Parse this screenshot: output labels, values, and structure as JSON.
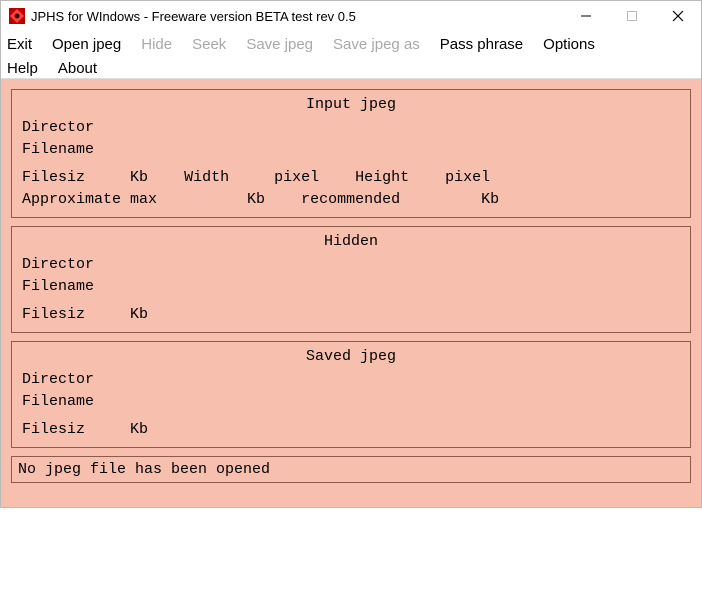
{
  "titlebar": {
    "title": "JPHS for WIndows - Freeware version BETA test rev 0.5"
  },
  "menu": {
    "row1": {
      "exit": "Exit",
      "open_jpeg": "Open jpeg",
      "hide": "Hide",
      "seek": "Seek",
      "save_jpeg": "Save jpeg",
      "save_jpeg_as": "Save jpeg as",
      "pass_phrase": "Pass phrase",
      "options": "Options"
    },
    "row2": {
      "help": "Help",
      "about": "About"
    }
  },
  "groups": {
    "input": {
      "caption": "Input jpeg",
      "directory_lbl": "Director",
      "filename_lbl": "Filename",
      "filesize_lbl": "Filesiz",
      "kb1": "Kb",
      "width_lbl": "Width",
      "pixel1": "pixel",
      "height_lbl": "Height",
      "pixel2": "pixel",
      "approx_lbl": "Approximate max",
      "kb2": "Kb",
      "rec_lbl": "recommended",
      "kb3": "Kb"
    },
    "hidden": {
      "caption": "Hidden",
      "directory_lbl": "Director",
      "filename_lbl": "Filename",
      "filesize_lbl": "Filesiz",
      "kb": "Kb"
    },
    "saved": {
      "caption": "Saved jpeg",
      "directory_lbl": "Director",
      "filename_lbl": "Filename",
      "filesize_lbl": "Filesiz",
      "kb": "Kb"
    }
  },
  "status": {
    "text": "No jpeg file has been opened"
  }
}
